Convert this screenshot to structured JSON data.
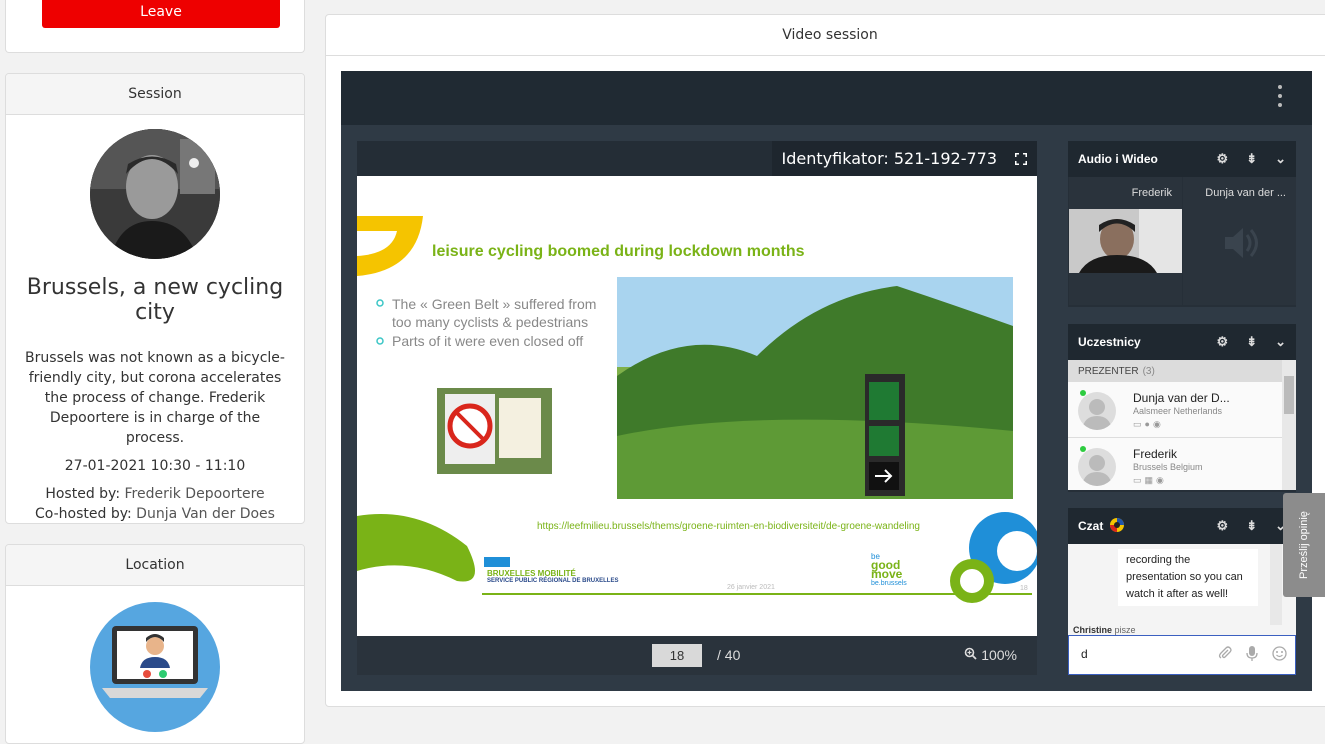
{
  "leave": {
    "label": "Leave"
  },
  "session": {
    "header": "Session",
    "title": "Brussels, a new cycling city",
    "description": "Brussels was not known as a bicycle-friendly city, but corona accelerates the process of change. Frederik Depoortere is in charge of the process.",
    "datetime": "27-01-2021 10:30 - 11:10",
    "hosted_label": "Hosted by:",
    "host": "Frederik Depoortere",
    "cohosted_label": "Co-hosted by:",
    "cohost": "Dunja Van der Does"
  },
  "location": {
    "header": "Location"
  },
  "video": {
    "header": "Video session",
    "identifier": "Identyfikator: 521-192-773",
    "slide": {
      "title": "leisure cycling boomed during lockdown months",
      "bullet1a": "The « Green Belt » suffered from",
      "bullet1b": "too many cyclists & pedestrians",
      "bullet2": "Parts of it were even closed off",
      "url": "https://leefmilieu.brussels/thems/groene-ruimten-en-biodiversiteit/de-groene-wandeling",
      "org1": "BRUXELLES MOBILITÉ",
      "org2": "SERVICE PUBLIC RÉGIONAL DE BRUXELLES",
      "date": "26 janvier 2021",
      "logo1": "be",
      "logo2": "good",
      "logo3": "move",
      "logo4": "be.brussels",
      "num": "18"
    },
    "page_current": "18",
    "page_total": "/ 40",
    "zoom": "100%"
  },
  "audio_video": {
    "title": "Audio i Wideo",
    "tiles": [
      {
        "name": "Frederik"
      },
      {
        "name": "Dunja van der ..."
      }
    ]
  },
  "participants": {
    "title": "Uczestnicy",
    "section": "PREZENTER",
    "count": "(3)",
    "list": [
      {
        "name": "Dunja van der D...",
        "location": "Aalsmeer Netherlands"
      },
      {
        "name": "Frederik",
        "location": "Brussels Belgium"
      }
    ]
  },
  "chat": {
    "title": "Czat",
    "message": "recording the presentation so you can watch it after as well!",
    "typing_name": "Christine",
    "typing_suffix": "pisze",
    "input_value": "d"
  },
  "feedback": {
    "label": "Prześlij opinię"
  },
  "colors": {
    "leave": "#ee0000",
    "player_bg": "#2f3a45",
    "slide_green": "#7ab317",
    "slide_yellow": "#f5c400"
  }
}
